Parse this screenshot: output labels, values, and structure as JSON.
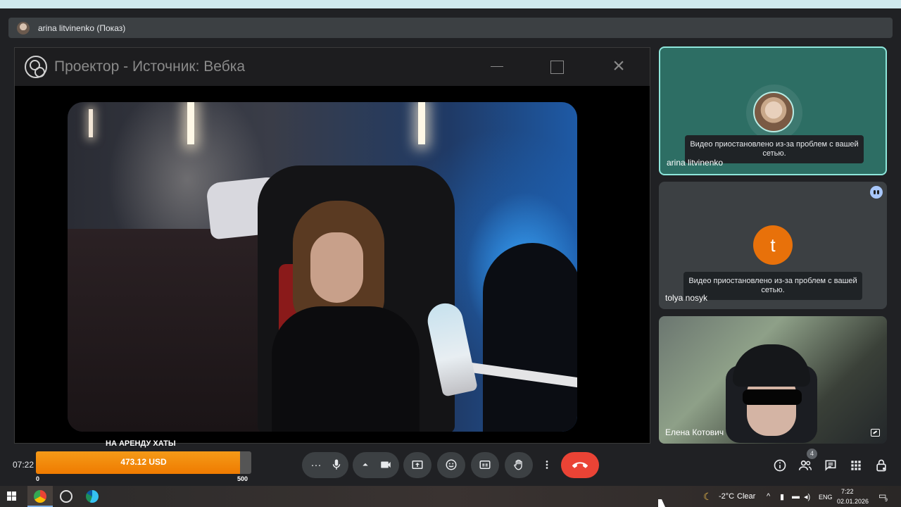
{
  "presenter": {
    "label": "arina litvinenko (Показ)"
  },
  "projector": {
    "title": "Проектор - Источник: Вебка"
  },
  "participants": [
    {
      "name": "arina litvinenko",
      "warning": "Видео приостановлено из-за проблем с вашей сетью.",
      "avatar": "photo",
      "active_speaker": true
    },
    {
      "name": "tolya nosyk",
      "warning": "Видео приостановлено из-за проблем с вашей сетью.",
      "avatar_letter": "t",
      "avatar_color": "#e8710a"
    },
    {
      "name": "Елена Котович",
      "video": true
    }
  ],
  "meeting": {
    "time": "07:22"
  },
  "goal": {
    "title": "НА АРЕНДУ ХАТЫ",
    "amount_label": "473.12 USD",
    "current": 473.12,
    "min": 0,
    "max": 500,
    "min_label": "0",
    "max_label": "500"
  },
  "controls": {
    "icons": [
      "more-options-icon",
      "microphone-icon",
      "chevron-up-icon",
      "camera-icon",
      "present-screen-icon",
      "emoji-icon",
      "captions-icon",
      "raise-hand-icon",
      "more-vert-icon",
      "end-call-icon"
    ],
    "end_call_color": "#ea4335"
  },
  "side_panel": {
    "icons": [
      "info-icon",
      "people-icon",
      "chat-icon",
      "activities-icon",
      "host-controls-icon"
    ],
    "people_count": "4"
  },
  "taskbar": {
    "weather_temp": "-2°C",
    "weather_text": "Clear",
    "language": "ENG",
    "time": "7:22",
    "date": "02.01.2026",
    "notifications": "9"
  }
}
